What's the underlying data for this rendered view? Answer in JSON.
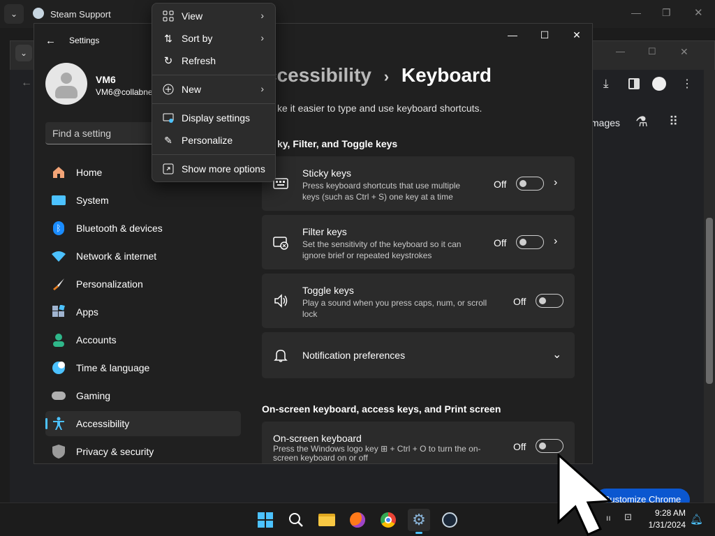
{
  "steam_window": {
    "title": "Steam Support"
  },
  "chrome_window": {
    "images_label": "mages",
    "customize_label": "Customize Chrome"
  },
  "settings": {
    "app_title": "Settings",
    "user": {
      "name": "VM6",
      "email": "VM6@collabne"
    },
    "search_placeholder": "Find a setting",
    "nav": [
      {
        "label": "Home",
        "icon": "home-icon"
      },
      {
        "label": "System",
        "icon": "system-icon"
      },
      {
        "label": "Bluetooth & devices",
        "icon": "bluetooth-icon"
      },
      {
        "label": "Network & internet",
        "icon": "wifi-icon"
      },
      {
        "label": "Personalization",
        "icon": "brush-icon"
      },
      {
        "label": "Apps",
        "icon": "apps-icon"
      },
      {
        "label": "Accounts",
        "icon": "person-icon"
      },
      {
        "label": "Time & language",
        "icon": "globe-icon"
      },
      {
        "label": "Gaming",
        "icon": "gamepad-icon"
      },
      {
        "label": "Accessibility",
        "icon": "accessibility-icon"
      },
      {
        "label": "Privacy & security",
        "icon": "shield-icon"
      }
    ],
    "selected_nav": "Accessibility",
    "breadcrumb": {
      "parent": "ccessibility",
      "separator": "›",
      "current": "Keyboard"
    },
    "subtitle": "ke it easier to type and use keyboard shortcuts.",
    "section1": "ky, Filter, and Toggle keys",
    "cards": {
      "sticky": {
        "title": "Sticky keys",
        "desc1": "Press keyboard shortcuts that use multiple",
        "desc2": "keys (such as Ctrl + S) one key at a time",
        "state": "Off"
      },
      "filter": {
        "title": "Filter keys",
        "desc1": "Set the sensitivity of the keyboard so it can",
        "desc2": "ignore brief or repeated keystrokes",
        "state": "Off"
      },
      "toggle": {
        "title": "Toggle keys",
        "desc1": "Play a sound when you press caps, num, or scroll",
        "desc2": "lock",
        "state": "Off"
      },
      "notif": {
        "title": "Notification preferences"
      },
      "osk": {
        "title": "On-screen keyboard",
        "desc1": "Press the Windows logo key ⊞ + Ctrl + O to turn the on-",
        "desc2": "screen keyboard on or off",
        "state": "Off"
      }
    },
    "section2": "On-screen keyboard, access keys, and Print screen"
  },
  "context_menu": {
    "items": [
      {
        "label": "View",
        "icon": "grid-icon",
        "submenu": true
      },
      {
        "label": "Sort by",
        "icon": "sort-icon",
        "submenu": true
      },
      {
        "label": "Refresh",
        "icon": "refresh-icon",
        "submenu": false
      },
      {
        "label": "New",
        "icon": "plus-circle-icon",
        "submenu": true
      },
      {
        "label": "Display settings",
        "icon": "display-icon",
        "submenu": false
      },
      {
        "label": "Personalize",
        "icon": "pen-icon",
        "submenu": false
      },
      {
        "label": "Show more options",
        "icon": "expand-icon",
        "submenu": false
      }
    ]
  },
  "taskbar": {
    "time": "9:28 AM",
    "date": "1/31/2024"
  },
  "colors": {
    "accent": "#4cc2ff",
    "window_bg": "#202020",
    "card_bg": "#2b2b2b"
  }
}
